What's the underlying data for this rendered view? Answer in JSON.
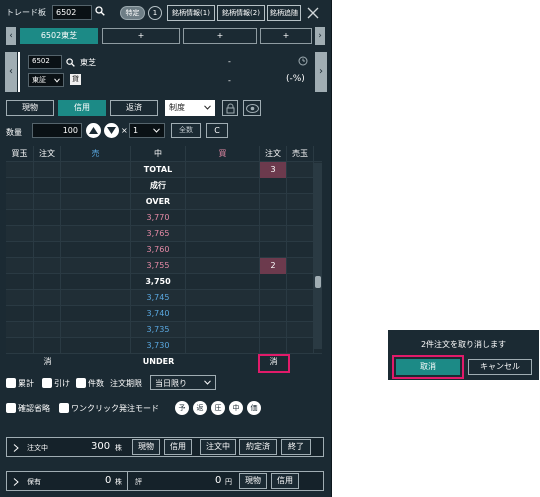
{
  "title_bar": {
    "title": "トレード板",
    "code_value": "6502",
    "tokutei_label": "特定",
    "circle_label": "1",
    "buttons": [
      "銘柄情報(1)",
      "銘柄情報(2)",
      "銘柄追随"
    ]
  },
  "tabs": {
    "left_arrow": "‹",
    "right_arrow": "›",
    "items": [
      {
        "label": "6502東芝"
      },
      {
        "label": "+"
      },
      {
        "label": "+"
      },
      {
        "label": "+"
      }
    ]
  },
  "stock_info": {
    "code": "6502",
    "name": "東芝",
    "market": "東証",
    "kashi": "貸",
    "price": "-",
    "change": "-",
    "change_pct": "(-%)",
    "left_arrow": "‹",
    "right_arrow": "›"
  },
  "order_types": [
    "現物",
    "信用",
    "返済"
  ],
  "seido_label": "制度",
  "quantity": {
    "label": "数量",
    "value": "100",
    "times": "×",
    "unit_value": "1",
    "all_label": "全数",
    "clear_label": "C"
  },
  "board": {
    "headers": [
      "買玉",
      "注文",
      "売",
      "中",
      "買",
      "注文",
      "売玉"
    ],
    "rows": [
      {
        "price": "TOTAL",
        "kind": "label",
        "buy_order": "3"
      },
      {
        "price": "成行",
        "kind": "label",
        "buy_order": ""
      },
      {
        "price": "OVER",
        "kind": "label",
        "buy_order": ""
      },
      {
        "price": "3,770",
        "kind": "sell",
        "buy_order": ""
      },
      {
        "price": "3,765",
        "kind": "sell",
        "buy_order": ""
      },
      {
        "price": "3,760",
        "kind": "sell",
        "buy_order": ""
      },
      {
        "price": "3,755",
        "kind": "sell",
        "buy_order": "2"
      },
      {
        "price": "3,750",
        "kind": "mid",
        "buy_order": ""
      },
      {
        "price": "3,745",
        "kind": "buy",
        "buy_order": ""
      },
      {
        "price": "3,740",
        "kind": "buy",
        "buy_order": ""
      },
      {
        "price": "3,735",
        "kind": "buy",
        "buy_order": ""
      },
      {
        "price": "3,730",
        "kind": "buy",
        "buy_order": ""
      }
    ],
    "under": {
      "left_cancel": "消",
      "price": "UNDER",
      "right_cancel": "消"
    }
  },
  "options": {
    "row1": [
      "累計",
      "引け",
      "件数"
    ],
    "toki_label": "注文期限",
    "toki_value": "当日限り",
    "row2": [
      "確認省略",
      "ワンクリック発注モード"
    ],
    "mode_circles": [
      "予",
      "返",
      "圧",
      "中",
      "価"
    ]
  },
  "order_bar": {
    "label": "注文中",
    "count": "300",
    "unit": "株",
    "buttons": [
      "現物",
      "信用",
      "注文中",
      "約定済",
      "終了"
    ]
  },
  "holding_bar": {
    "label": "保有",
    "count": "0",
    "unit": "株",
    "eval_label": "評",
    "eval_value": "0",
    "eval_unit": "円",
    "buttons": [
      "現物",
      "信用"
    ]
  },
  "dialog": {
    "message": "2件注文を取り消します",
    "ok_label": "取消",
    "cancel_label": "キャンセル"
  },
  "colors": {
    "panel": "#1b2a33",
    "accent": "#1c8a86",
    "sell_price": "#e58aa6",
    "buy_price": "#5aa8e0",
    "highlight": "#e11b6a",
    "pink_cell": "#6c3a4d"
  }
}
